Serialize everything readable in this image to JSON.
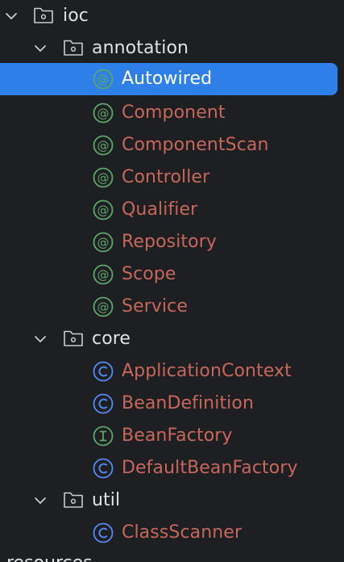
{
  "tree": {
    "root": {
      "label": "ioc",
      "children": {
        "annotation": {
          "label": "annotation",
          "items": [
            {
              "label": "Autowired",
              "icon": "annotation-icon",
              "selected": true
            },
            {
              "label": "Component",
              "icon": "annotation-icon"
            },
            {
              "label": "ComponentScan",
              "icon": "annotation-icon"
            },
            {
              "label": "Controller",
              "icon": "annotation-icon"
            },
            {
              "label": "Qualifier",
              "icon": "annotation-icon"
            },
            {
              "label": "Repository",
              "icon": "annotation-icon"
            },
            {
              "label": "Scope",
              "icon": "annotation-icon"
            },
            {
              "label": "Service",
              "icon": "annotation-icon"
            }
          ]
        },
        "core": {
          "label": "core",
          "items": [
            {
              "label": "ApplicationContext",
              "icon": "class-icon"
            },
            {
              "label": "BeanDefinition",
              "icon": "class-icon"
            },
            {
              "label": "BeanFactory",
              "icon": "interface-icon"
            },
            {
              "label": "DefaultBeanFactory",
              "icon": "class-icon"
            }
          ]
        },
        "util": {
          "label": "util",
          "items": [
            {
              "label": "ClassScanner",
              "icon": "class-icon"
            }
          ]
        }
      }
    },
    "partial_next": "resources"
  },
  "colors": {
    "background": "#1e1f22",
    "selection": "#2f7fe8",
    "package_text": "#dfe1e5",
    "class_text": "#c7675c",
    "annotation_icon": "#59a869",
    "class_icon": "#548af7",
    "interface_icon": "#59a869"
  }
}
